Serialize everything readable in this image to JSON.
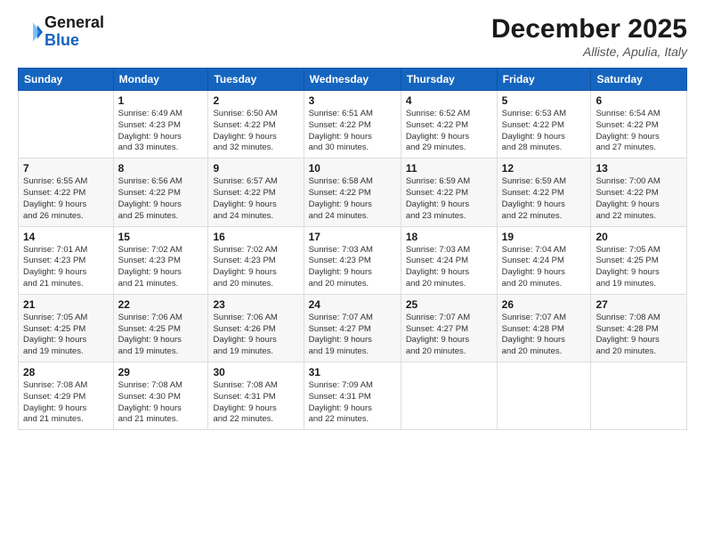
{
  "header": {
    "logo_line1": "General",
    "logo_line2": "Blue",
    "month_title": "December 2025",
    "location": "Alliste, Apulia, Italy"
  },
  "weekdays": [
    "Sunday",
    "Monday",
    "Tuesday",
    "Wednesday",
    "Thursday",
    "Friday",
    "Saturday"
  ],
  "weeks": [
    [
      {
        "day": "",
        "info": ""
      },
      {
        "day": "1",
        "info": "Sunrise: 6:49 AM\nSunset: 4:23 PM\nDaylight: 9 hours\nand 33 minutes."
      },
      {
        "day": "2",
        "info": "Sunrise: 6:50 AM\nSunset: 4:22 PM\nDaylight: 9 hours\nand 32 minutes."
      },
      {
        "day": "3",
        "info": "Sunrise: 6:51 AM\nSunset: 4:22 PM\nDaylight: 9 hours\nand 30 minutes."
      },
      {
        "day": "4",
        "info": "Sunrise: 6:52 AM\nSunset: 4:22 PM\nDaylight: 9 hours\nand 29 minutes."
      },
      {
        "day": "5",
        "info": "Sunrise: 6:53 AM\nSunset: 4:22 PM\nDaylight: 9 hours\nand 28 minutes."
      },
      {
        "day": "6",
        "info": "Sunrise: 6:54 AM\nSunset: 4:22 PM\nDaylight: 9 hours\nand 27 minutes."
      }
    ],
    [
      {
        "day": "7",
        "info": "Sunrise: 6:55 AM\nSunset: 4:22 PM\nDaylight: 9 hours\nand 26 minutes."
      },
      {
        "day": "8",
        "info": "Sunrise: 6:56 AM\nSunset: 4:22 PM\nDaylight: 9 hours\nand 25 minutes."
      },
      {
        "day": "9",
        "info": "Sunrise: 6:57 AM\nSunset: 4:22 PM\nDaylight: 9 hours\nand 24 minutes."
      },
      {
        "day": "10",
        "info": "Sunrise: 6:58 AM\nSunset: 4:22 PM\nDaylight: 9 hours\nand 24 minutes."
      },
      {
        "day": "11",
        "info": "Sunrise: 6:59 AM\nSunset: 4:22 PM\nDaylight: 9 hours\nand 23 minutes."
      },
      {
        "day": "12",
        "info": "Sunrise: 6:59 AM\nSunset: 4:22 PM\nDaylight: 9 hours\nand 22 minutes."
      },
      {
        "day": "13",
        "info": "Sunrise: 7:00 AM\nSunset: 4:22 PM\nDaylight: 9 hours\nand 22 minutes."
      }
    ],
    [
      {
        "day": "14",
        "info": "Sunrise: 7:01 AM\nSunset: 4:23 PM\nDaylight: 9 hours\nand 21 minutes."
      },
      {
        "day": "15",
        "info": "Sunrise: 7:02 AM\nSunset: 4:23 PM\nDaylight: 9 hours\nand 21 minutes."
      },
      {
        "day": "16",
        "info": "Sunrise: 7:02 AM\nSunset: 4:23 PM\nDaylight: 9 hours\nand 20 minutes."
      },
      {
        "day": "17",
        "info": "Sunrise: 7:03 AM\nSunset: 4:23 PM\nDaylight: 9 hours\nand 20 minutes."
      },
      {
        "day": "18",
        "info": "Sunrise: 7:03 AM\nSunset: 4:24 PM\nDaylight: 9 hours\nand 20 minutes."
      },
      {
        "day": "19",
        "info": "Sunrise: 7:04 AM\nSunset: 4:24 PM\nDaylight: 9 hours\nand 20 minutes."
      },
      {
        "day": "20",
        "info": "Sunrise: 7:05 AM\nSunset: 4:25 PM\nDaylight: 9 hours\nand 19 minutes."
      }
    ],
    [
      {
        "day": "21",
        "info": "Sunrise: 7:05 AM\nSunset: 4:25 PM\nDaylight: 9 hours\nand 19 minutes."
      },
      {
        "day": "22",
        "info": "Sunrise: 7:06 AM\nSunset: 4:25 PM\nDaylight: 9 hours\nand 19 minutes."
      },
      {
        "day": "23",
        "info": "Sunrise: 7:06 AM\nSunset: 4:26 PM\nDaylight: 9 hours\nand 19 minutes."
      },
      {
        "day": "24",
        "info": "Sunrise: 7:07 AM\nSunset: 4:27 PM\nDaylight: 9 hours\nand 19 minutes."
      },
      {
        "day": "25",
        "info": "Sunrise: 7:07 AM\nSunset: 4:27 PM\nDaylight: 9 hours\nand 20 minutes."
      },
      {
        "day": "26",
        "info": "Sunrise: 7:07 AM\nSunset: 4:28 PM\nDaylight: 9 hours\nand 20 minutes."
      },
      {
        "day": "27",
        "info": "Sunrise: 7:08 AM\nSunset: 4:28 PM\nDaylight: 9 hours\nand 20 minutes."
      }
    ],
    [
      {
        "day": "28",
        "info": "Sunrise: 7:08 AM\nSunset: 4:29 PM\nDaylight: 9 hours\nand 21 minutes."
      },
      {
        "day": "29",
        "info": "Sunrise: 7:08 AM\nSunset: 4:30 PM\nDaylight: 9 hours\nand 21 minutes."
      },
      {
        "day": "30",
        "info": "Sunrise: 7:08 AM\nSunset: 4:31 PM\nDaylight: 9 hours\nand 22 minutes."
      },
      {
        "day": "31",
        "info": "Sunrise: 7:09 AM\nSunset: 4:31 PM\nDaylight: 9 hours\nand 22 minutes."
      },
      {
        "day": "",
        "info": ""
      },
      {
        "day": "",
        "info": ""
      },
      {
        "day": "",
        "info": ""
      }
    ]
  ]
}
